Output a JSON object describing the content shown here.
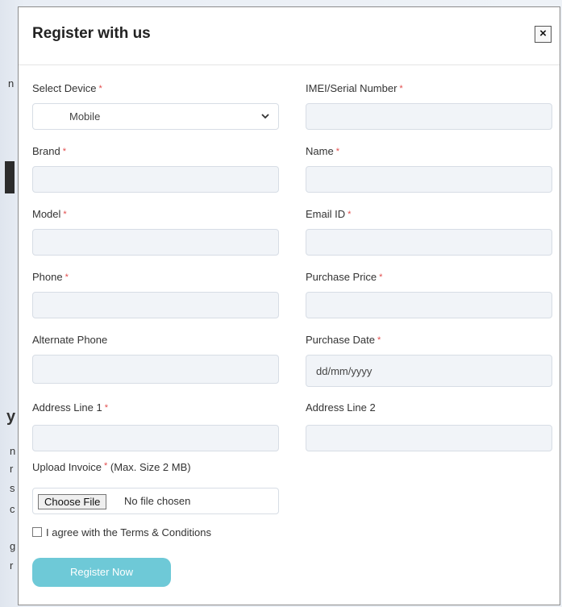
{
  "modal": {
    "title": "Register with us",
    "close_label": "×"
  },
  "form": {
    "required_marker": "*",
    "select_device": {
      "label": "Select Device",
      "value": "Mobile"
    },
    "imei": {
      "label": "IMEI/Serial Number",
      "value": ""
    },
    "brand": {
      "label": "Brand",
      "value": ""
    },
    "name": {
      "label": "Name",
      "value": ""
    },
    "model": {
      "label": "Model",
      "value": ""
    },
    "email": {
      "label": "Email ID",
      "value": ""
    },
    "phone": {
      "label": "Phone",
      "value": ""
    },
    "purchase_price": {
      "label": "Purchase Price",
      "value": ""
    },
    "alternate_phone": {
      "label": "Alternate Phone",
      "value": ""
    },
    "purchase_date": {
      "label": "Purchase Date",
      "placeholder": "dd/mm/yyyy"
    },
    "address_line_1": {
      "label": "Address Line 1",
      "value": ""
    },
    "address_line_2": {
      "label": "Address Line 2",
      "value": ""
    },
    "upload": {
      "label": "Upload Invoice",
      "note": "(Max. Size 2 MB)",
      "button_label": "Choose File",
      "status": "No file chosen"
    },
    "terms_label": "I agree with the Terms & Conditions",
    "submit_label": "Register Now"
  },
  "background_fragments": [
    "n",
    "y",
    "n",
    "r",
    "s",
    "c",
    "g",
    "r"
  ],
  "colors": {
    "accent": "#6ec9d7",
    "required": "#e24b4b",
    "input_bg": "#f1f4f8"
  },
  "icons": {
    "close": "close-icon",
    "select_chevron": "chevron-down-icon"
  }
}
